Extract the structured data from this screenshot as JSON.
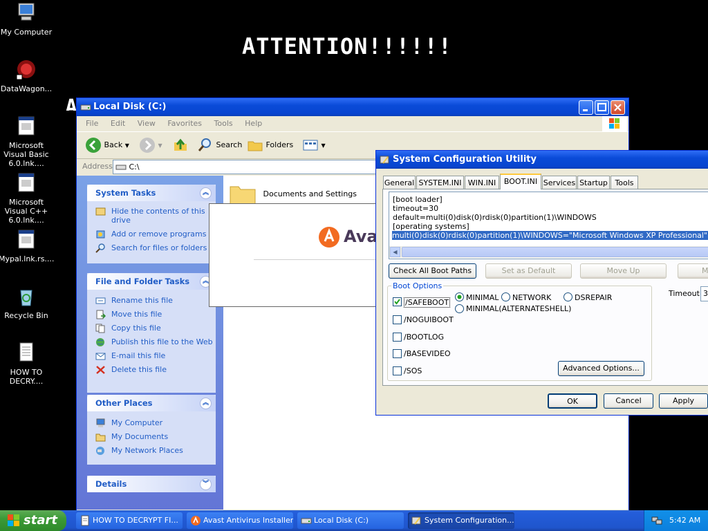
{
  "desktop": {
    "icons": [
      {
        "label": "My Computer",
        "icon": "my-computer-icon"
      },
      {
        "label": "DataWagon...",
        "icon": "datawagon-icon"
      },
      {
        "label": "Microsoft Visual Basic 6.0.lnk....",
        "icon": "vb-shortcut-icon"
      },
      {
        "label": "Microsoft Visual C++ 6.0.lnk....",
        "icon": "vcpp-shortcut-icon"
      },
      {
        "label": "Mypal.lnk.rs....",
        "icon": "mypal-shortcut-icon"
      },
      {
        "label": "Recycle Bin",
        "icon": "recycle-bin-icon"
      },
      {
        "label": "HOW TO DECRY....",
        "icon": "text-file-icon"
      }
    ],
    "ransom_heading": "ATTENTION!!!!!!",
    "ransom_line_partial": "ALL YOUR PERSONAL FILES WERE ENCRYPTED"
  },
  "explorer": {
    "title": "Local Disk (C:)",
    "menu": [
      "File",
      "Edit",
      "View",
      "Favorites",
      "Tools",
      "Help"
    ],
    "toolbar": {
      "back": "Back",
      "search": "Search",
      "folders": "Folders"
    },
    "address_label": "Address",
    "address_value": "C:\\",
    "system_tasks": {
      "title": "System Tasks",
      "items": [
        "Hide the contents of this drive",
        "Add or remove programs",
        "Search for files or folders"
      ]
    },
    "file_folder_tasks": {
      "title": "File and Folder Tasks",
      "items": [
        "Rename this file",
        "Move this file",
        "Copy this file",
        "Publish this file to the Web",
        "E-mail this file",
        "Delete this file"
      ]
    },
    "other_places": {
      "title": "Other Places",
      "items": [
        "My Computer",
        "My Documents",
        "My Network Places"
      ]
    },
    "details": {
      "title": "Details"
    },
    "files": [
      {
        "name": "Documents and Settings"
      }
    ]
  },
  "avast_popup": {
    "brand": "Avas"
  },
  "msconfig": {
    "title": "System Configuration Utility",
    "tabs": [
      "General",
      "SYSTEM.INI",
      "WIN.INI",
      "BOOT.INI",
      "Services",
      "Startup",
      "Tools"
    ],
    "active_tab": "BOOT.INI",
    "bootini_lines": [
      "[boot loader]",
      "timeout=30",
      "default=multi(0)disk(0)rdisk(0)partition(1)\\WINDOWS",
      "[operating systems]"
    ],
    "bootini_selected_line": "multi(0)disk(0)rdisk(0)partition(1)\\WINDOWS=\"Microsoft Windows XP Professional\" /noexecute=",
    "buttons": {
      "check_all_boot_paths": "Check All Boot Paths",
      "set_as_default": "Set as Default",
      "move_up": "Move Up",
      "move_down_partial": "Mo",
      "advanced_options": "Advanced Options...",
      "ok": "OK",
      "cancel": "Cancel",
      "apply": "Apply"
    },
    "boot_options": {
      "title": "Boot Options",
      "checkboxes": [
        {
          "label": "/SAFEBOOT",
          "checked": true
        },
        {
          "label": "/NOGUIBOOT",
          "checked": false
        },
        {
          "label": "/BOOTLOG",
          "checked": false
        },
        {
          "label": "/BASEVIDEO",
          "checked": false
        },
        {
          "label": "/SOS",
          "checked": false
        }
      ],
      "radios": [
        {
          "label": "MINIMAL",
          "selected": true
        },
        {
          "label": "NETWORK",
          "selected": false
        },
        {
          "label": "DSREPAIR",
          "selected": false
        },
        {
          "label": "MINIMAL(ALTERNATESHELL)",
          "selected": false
        }
      ]
    },
    "timeout_label": "Timeout:",
    "timeout_value_partial": "3"
  },
  "taskbar": {
    "start_label": "start",
    "tasks": [
      {
        "label": "HOW TO DECRYPT FI...",
        "active": false
      },
      {
        "label": "Avast Antivirus Installer",
        "active": false
      },
      {
        "label": "Local Disk (C:)",
        "active": false
      },
      {
        "label": "System Configuration...",
        "active": true
      }
    ],
    "clock": "5:42 AM"
  },
  "colors": {
    "xp_blue": "#0a4bd8",
    "panel_link": "#215dc6",
    "start_green": "#3c9a37",
    "avast_orange": "#f26b21"
  }
}
